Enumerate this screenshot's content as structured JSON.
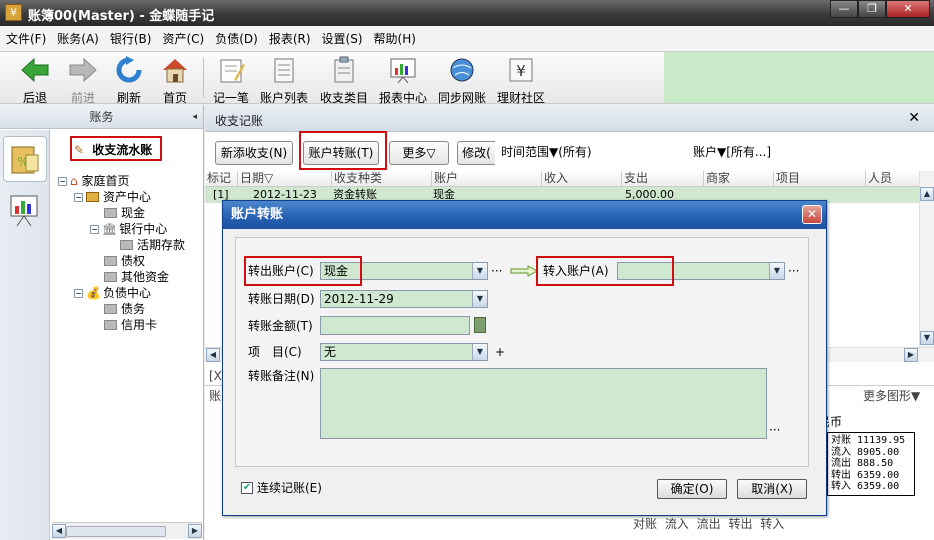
{
  "window": {
    "title": "账簿00(Master) - 金蝶随手记"
  },
  "menu": [
    "文件(F)",
    "账务(A)",
    "银行(B)",
    "资产(C)",
    "负债(D)",
    "报表(R)",
    "设置(S)",
    "帮助(H)"
  ],
  "toolbar": {
    "back": "后退",
    "forward": "前进",
    "refresh": "刷新",
    "home": "首页",
    "record": "记一笔",
    "accounts": "账户列表",
    "categories": "收支类目",
    "reports": "报表中心",
    "sync": "同步网账",
    "community": "理财社区"
  },
  "left": {
    "header": "账务",
    "tree": {
      "ledger": "收支流水账",
      "home": "家庭首页",
      "assets": "资产中心",
      "cash": "现金",
      "bank": "银行中心",
      "demand": "活期存款",
      "claims": "债权",
      "other_funds": "其他资金",
      "liabilities": "负债中心",
      "debt": "债务",
      "credit_card": "信用卡"
    }
  },
  "main": {
    "header": "收支记账",
    "buttons": {
      "new": "新添收支(N)",
      "transfer": "账户转账(T)",
      "more": "更多▽",
      "modify": "修改("
    },
    "filter": {
      "time_range": "时间范围▼(所有)",
      "account": "账户▼[所有...]"
    },
    "columns": [
      "标记",
      "日期▽",
      "收支种类",
      "账户",
      "收入",
      "支出",
      "商家",
      "项目",
      "人员"
    ],
    "row": {
      "mark": "[1]",
      "date": "2012-11-23",
      "type": "资金转账",
      "account": "现金",
      "expense": "5,000.00"
    },
    "more_charts": "更多图形▼",
    "currency_tail": "民币",
    "stats": [
      {
        "label": "对账",
        "value": "11139.95"
      },
      {
        "label": "流入",
        "value": "8905.00"
      },
      {
        "label": "流出",
        "value": "888.50"
      },
      {
        "label": "转出",
        "value": "6359.00"
      },
      {
        "label": "转入",
        "value": "6359.00"
      }
    ],
    "legend": "对账 流入 流出 转出 转入",
    "side_fragments": {
      "bracket": "[X",
      "account_fragment": "账"
    }
  },
  "dialog": {
    "title": "账户转账",
    "from_label": "转出账户(C)",
    "from_value": "现金",
    "to_label": "转入账户(A)",
    "to_value": "",
    "date_label": "转账日期(D)",
    "date_value": "2012-11-29",
    "amount_label": "转账金额(T)",
    "amount_value": "",
    "project_label": "项　目(C)",
    "project_value": "无",
    "remark_label": "转账备注(N)",
    "remark_value": "",
    "continuous_label": "连续记账(E)",
    "ok": "确定(O)",
    "cancel": "取消(X)",
    "ellipsis": "···",
    "plus": "+"
  },
  "colors": {
    "highlight_red": "#d01010",
    "field_green": "#cfe8cf",
    "dialog_title_blue": "#2560b2"
  }
}
